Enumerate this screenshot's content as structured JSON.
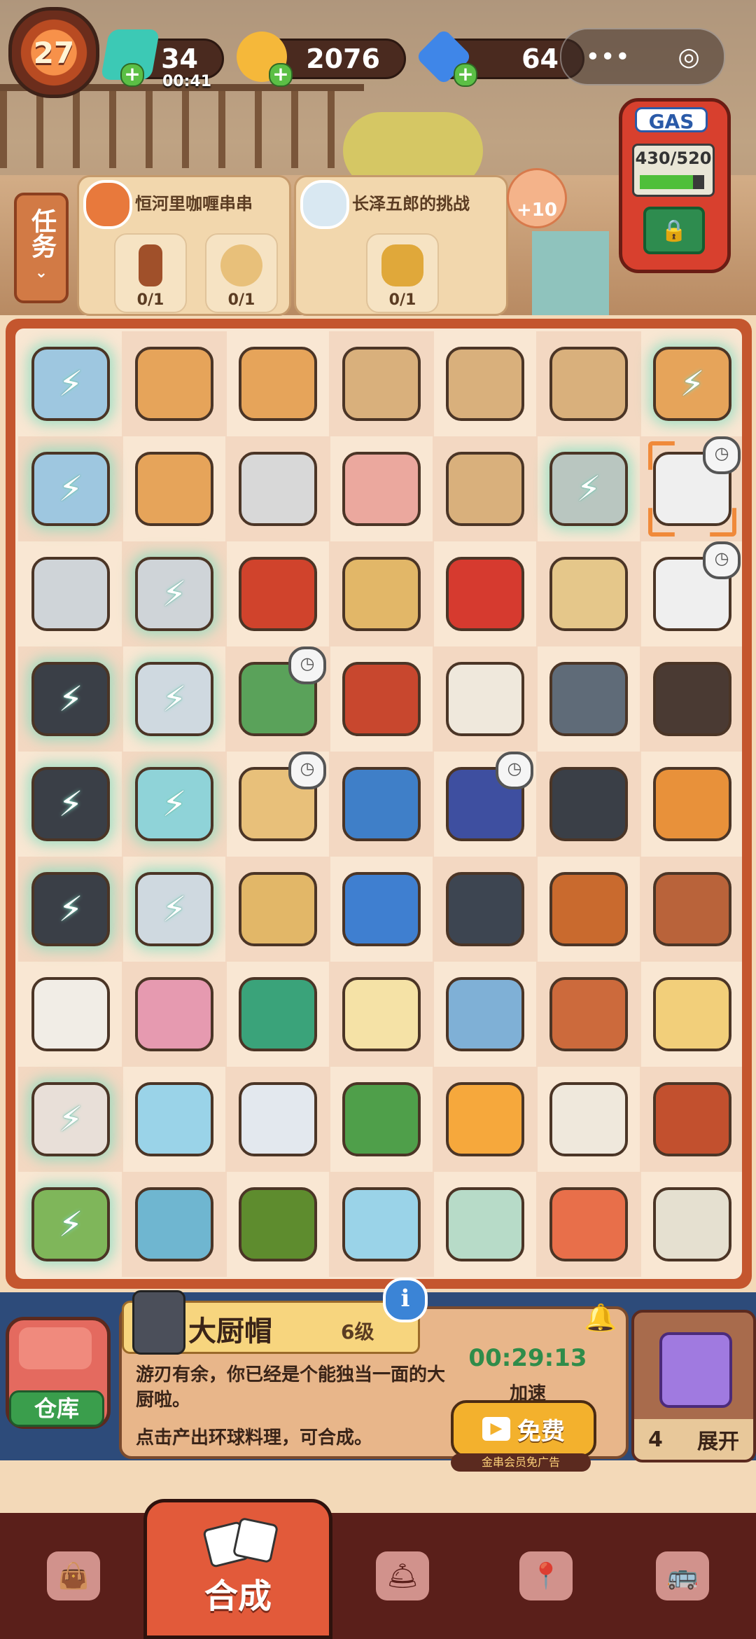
{
  "hud": {
    "level": "27",
    "energy": {
      "value": "34",
      "timer": "00:41",
      "color": "#3cc9b5"
    },
    "coins": {
      "value": "2076",
      "color": "#f5b83a"
    },
    "gems": {
      "value": "64",
      "color": "#3f86e8"
    },
    "menu_glyph": "•••",
    "close_glyph": "◎"
  },
  "tasks": {
    "tab_label": "任务",
    "card1": {
      "title": "恒河里咖喱串串",
      "reqs": [
        {
          "icon": "sauce-bottle-icon",
          "count": "0/1"
        },
        {
          "icon": "flatbread-icon",
          "count": "0/1"
        }
      ]
    },
    "card2": {
      "title": "长泽五郎的挑战",
      "reqs": [
        {
          "icon": "lucky-pot-icon",
          "count": "0/1"
        }
      ]
    },
    "bonus": "+10"
  },
  "gas": {
    "label": "GAS",
    "reading": "430/520",
    "fill_fraction": 0.83
  },
  "board": {
    "rows": 9,
    "cols": 7,
    "cells": [
      [
        "notebook-gen",
        "skewer-box",
        "skewer-box",
        "takeout-bag",
        "takeout-bag",
        "takeout-bag",
        "skewer-jar-gen"
      ],
      [
        "notebook-gen",
        "skewer-box",
        "receipt-printer",
        "ham-slices",
        "takeout-bag",
        "hotpot-gen",
        "chef-hat-selected"
      ],
      [
        "printer",
        "printer-gen",
        "chili-jar",
        "scallion-pancake",
        "ketchup",
        "seed-plate",
        "chef-hat"
      ],
      [
        "sushi-gift-gen",
        "fridge-gen",
        "scooter",
        "mala-jar",
        "rice-pile",
        "pot-lid",
        "grilled-dessert"
      ],
      [
        "sushi-gift-gen",
        "glass-fridge-gen",
        "drink-shelf",
        "blue-bag",
        "star-horn",
        "sushi-roll",
        "pizza"
      ],
      [
        "sushi-gift-gen",
        "fridge-gen",
        "scallion-pancake",
        "house",
        "stew-pot",
        "roast-chicken",
        "curry-plate"
      ],
      [
        "coconut-sack",
        "hairbrush",
        "scissors",
        "tofu",
        "tag-charm",
        "bbq-skewers",
        "pudding-tray"
      ],
      [
        "jar-gen",
        "parfait",
        "ice-shards",
        "watermelon",
        "egg",
        "rice-platter",
        "braised-pork"
      ],
      [
        "tree-gen",
        "puzzle-piece",
        "olive",
        "parfait",
        "ruler",
        "shrimp-bowl",
        "noodle-bowl"
      ]
    ]
  },
  "info": {
    "name": "大厨帽",
    "level": "6级",
    "desc1": "游刃有余，你已经是个能独当一面的大厨啦。",
    "desc2": "点击产出环球料理，可合成。",
    "timer": "00:29:13",
    "speed_label": "加速",
    "free_label": "免费",
    "vip_note": "金串会员免广告",
    "info_glyph": "i"
  },
  "storage": {
    "label": "仓库"
  },
  "mystery": {
    "count": "4",
    "expand": "展开"
  },
  "nav": {
    "active_label": "合成"
  }
}
